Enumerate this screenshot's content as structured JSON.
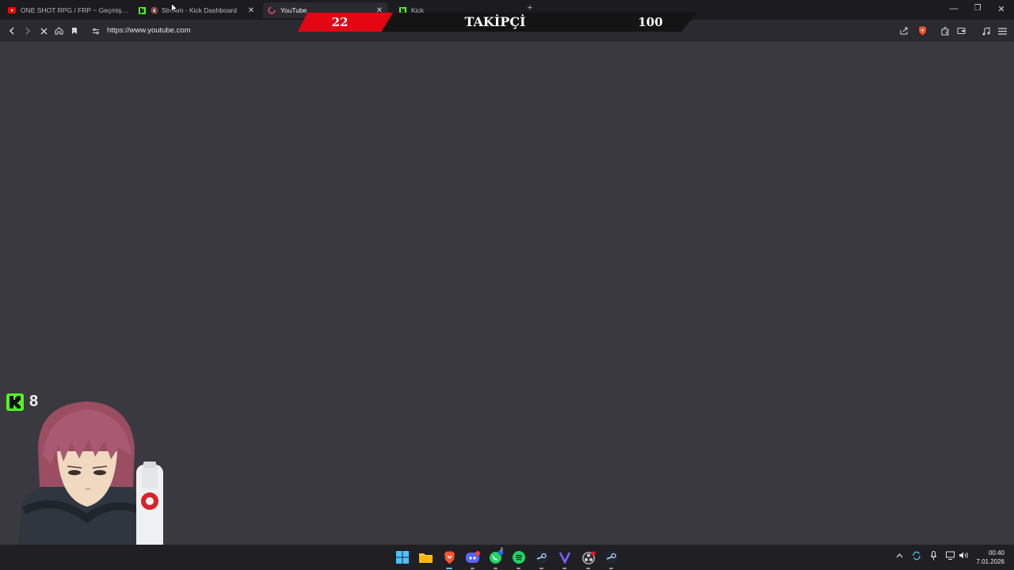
{
  "browser": {
    "tabs": [
      {
        "title": "ONE SHOT RPG / FRP ~ Geçmişin Yar",
        "favicon": "youtube-icon",
        "active": false
      },
      {
        "title": "Stream - Kick Dashboard",
        "favicon": "kick-icon",
        "active": false,
        "muted": true
      },
      {
        "title": "YouTube",
        "favicon": "loading-icon",
        "active": true
      },
      {
        "title": "Kick",
        "favicon": "kick-icon",
        "active": false
      }
    ],
    "new_tab_label": "+",
    "url": "https://www.youtube.com"
  },
  "overlay": {
    "follower_current": "22",
    "follower_title": "TAKİPÇİ",
    "follower_goal": "100",
    "follower_progress": 0.22,
    "viewer_count": "8"
  },
  "taskbar": {
    "apps": [
      "windows-start-icon",
      "file-explorer-icon",
      "brave-icon",
      "discord-icon",
      "whatsapp-icon",
      "spotify-icon",
      "steam-icon",
      "vivaldi-icon",
      "obs-icon",
      "steam-icon"
    ],
    "whatsapp_badge": "3",
    "clock_time": "00:40",
    "clock_date": "7.01.2026"
  },
  "colors": {
    "page_bg": "#3a393f",
    "tabbar_bg": "#1c1b20",
    "kick_green": "#53fc18",
    "follower_red": "#e30613",
    "taskbar_bg": "#1f1f24"
  }
}
